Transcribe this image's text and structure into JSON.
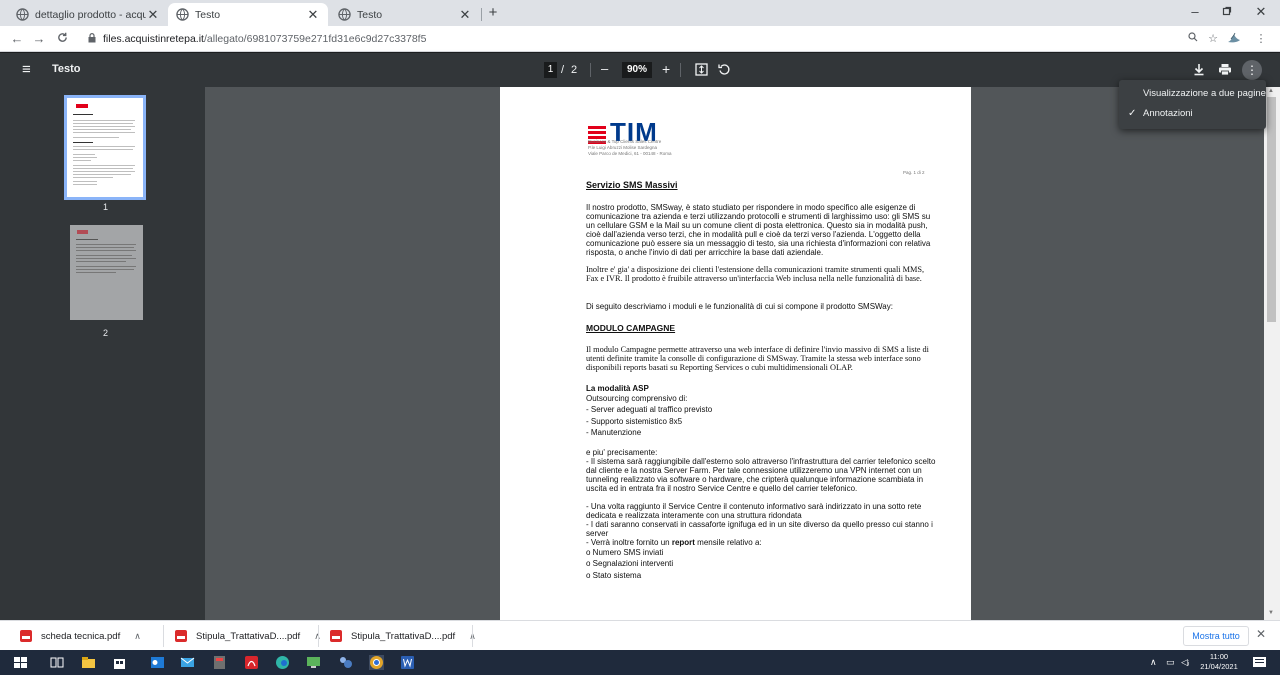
{
  "tabs": [
    {
      "label": "dettaglio prodotto - acquistinrete",
      "active": false
    },
    {
      "label": "Testo",
      "active": true
    },
    {
      "label": "Testo",
      "active": false
    }
  ],
  "window": {
    "minimize": "–",
    "maximize": "▫",
    "close": "✕",
    "new_tab": "+"
  },
  "address": {
    "host": "files.acquistinretepa.it",
    "path": "/allegato/6981073759e271fd31e6c9d27c3378f5"
  },
  "pdf_toolbar": {
    "title": "Testo",
    "current_page": "1",
    "page_sep": "/",
    "total_pages": "2",
    "zoom": "90%",
    "zoom_out": "–",
    "zoom_in": "+"
  },
  "thumbnails": [
    {
      "label": "1"
    },
    {
      "label": "2"
    }
  ],
  "menu": {
    "items": [
      {
        "label": "Visualizzazione a due pagine",
        "checked": false
      },
      {
        "label": "Annotazioni",
        "checked": true
      }
    ]
  },
  "document": {
    "logo": "TIM",
    "address_lines": [
      "Business & Top Clients Sales Centre",
      "P.le Luigi Abruzzi Molise Sardegna",
      "Viale Parco de Medici, 61 - 00148 - Roma"
    ],
    "page_label": "Pag. 1 di 2",
    "heading": "Servizio SMS Massivi",
    "intro_paragraph": "Il nostro prodotto, SMSway, è stato studiato per rispondere in modo specifico alle esigenze di comunicazione tra azienda e terzi utilizzando protocolli e strumenti di larghissimo uso: gli SMS su un cellulare GSM e la Mail su un comune client di posta elettronica. Questo sia in modalità push, cioè dall'azienda verso terzi, che in modalità pull e cioè da terzi verso l'azienda. L'oggetto della comunicazione può essere sia un messaggio di testo, sia una richiesta d'informazioni con relativa risposta, o anche l'invio di dati per arricchire la base dati aziendale.",
    "intro_serif": "Inoltre e' gia' a disposizione dei clienti l'estensione della comunicazioni tramite strumenti quali MMS, Fax e IVR. Il prodotto è fruibile attraverso un'interfaccia Web inclusa nella nelle funzionalità di base.",
    "modules_intro": "Di seguito descriviamo i moduli e le funzionalità di cui si compone il prodotto SMSWay:",
    "module_heading": "MODULO CAMPAGNE",
    "module_paragraph": "Il modulo Campagne permette attraverso una web interface di definire l'invio massivo di SMS a liste di utenti definite tramite la consolle di configurazione di SMSway. Tramite la stessa web interface sono disponibili reports basati su Reporting Services o cubi multidimensionali OLAP.",
    "asp_heading": "La modalità ASP",
    "asp_lines": [
      "Outsourcing comprensivo di:",
      "- Server adeguati al traffico previsto",
      "- Supporto sistemistico 8x5",
      "- Manutenzione"
    ],
    "precise_heading": "e piu' precisamente:",
    "precise_1": "- Il sistema sarà raggiungibile dall'esterno solo attraverso l'infrastruttura del carrier telefonico scelto dal cliente e la nostra Server Farm. Per tale connessione utilizzeremo una VPN internet con un tunneling realizzato via software o hardware, che cripterà qualunque informazione scambiata in uscita ed in entrata fra il nostro Service Centre e quello del carrier telefonico.",
    "precise_2": "- Una volta raggiunto il Service Centre il contenuto informativo sarà indirizzato in una sotto rete dedicata e realizzata interamente con una struttura ridondata",
    "precise_3": "- I dati saranno conservati in cassaforte ignifuga ed in un site diverso da quello presso cui stanno i server",
    "report_pre": "- Verrà inoltre fornito un ",
    "report_bold": "report",
    "report_post": " mensile relativo a:",
    "report_items": [
      "o   Numero SMS inviati",
      "o   Segnalazioni interventi",
      "o   Stato sistema"
    ]
  },
  "downloads": [
    {
      "name": "scheda tecnica.pdf"
    },
    {
      "name": "Stipula_TrattativaD....pdf"
    },
    {
      "name": "Stipula_TrattativaD....pdf"
    }
  ],
  "downloads_bar": {
    "show_all": "Mostra tutto",
    "close": "✕"
  },
  "taskbar": {
    "time": "11:00",
    "date": "21/04/2021"
  },
  "colors": {
    "tim_red": "#e2001a",
    "tim_blue": "#003a8c",
    "pdf_toolbar": "#323639",
    "pdf_canvas": "#525659"
  }
}
